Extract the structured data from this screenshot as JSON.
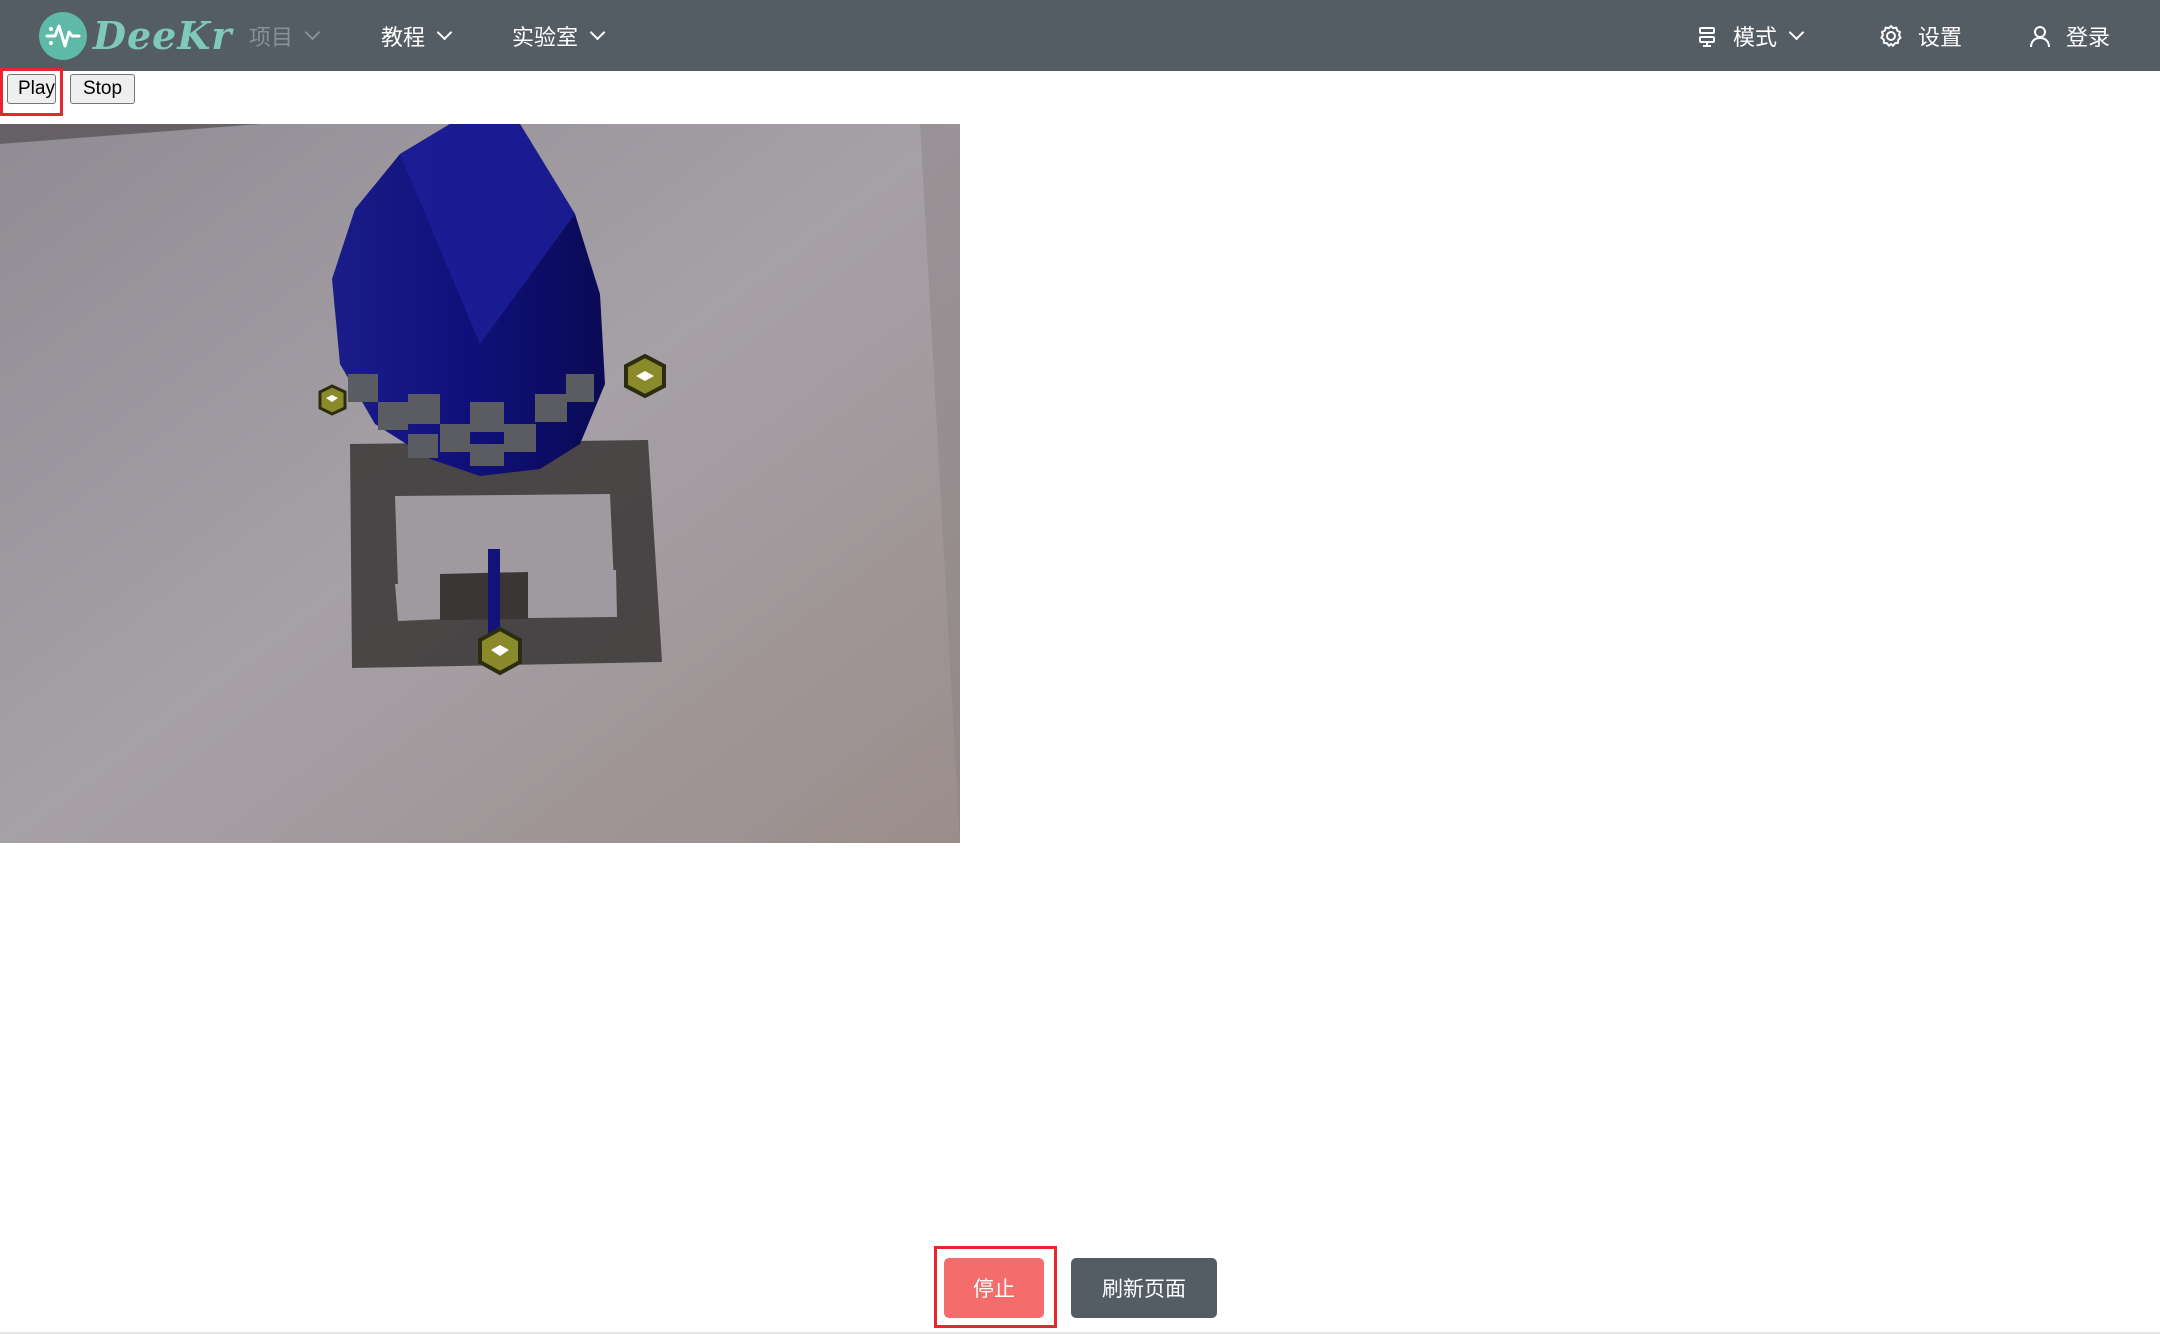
{
  "header": {
    "logo_text": "DeeKr",
    "nav": [
      {
        "label": "项目",
        "disabled": true
      },
      {
        "label": "教程",
        "disabled": false
      },
      {
        "label": "实验室",
        "disabled": false
      }
    ],
    "right": {
      "mode_label": "模式",
      "settings_label": "设置",
      "login_label": "登录"
    }
  },
  "controls": {
    "play_label": "Play",
    "stop_label": "Stop"
  },
  "footer": {
    "stop_label": "停止",
    "refresh_label": "刷新页面"
  },
  "colors": {
    "header_bg": "#545c64",
    "logo_accent": "#5fb9a8",
    "danger": "#f56c6c",
    "highlight": "#e8262b"
  },
  "icons": {
    "mode": "mode-icon",
    "settings": "gear-icon",
    "login": "user-icon"
  }
}
